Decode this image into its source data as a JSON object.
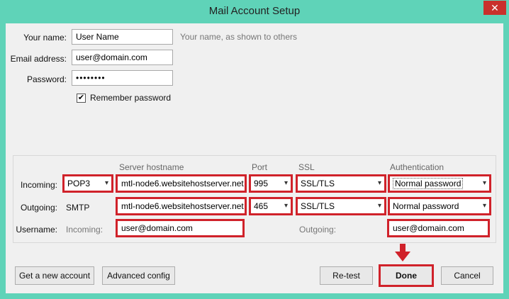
{
  "window": {
    "title": "Mail Account Setup",
    "close_glyph": "✕"
  },
  "identity": {
    "name_label": "Your name:",
    "name_value": "User Name",
    "name_hint": "Your name, as shown to others",
    "email_label": "Email address:",
    "email_value": "user@domain.com",
    "password_label": "Password:",
    "password_value": "••••••••",
    "remember_label": "Remember password",
    "remember_checked": "✔"
  },
  "server": {
    "headers": {
      "hostname": "Server hostname",
      "port": "Port",
      "ssl": "SSL",
      "auth": "Authentication"
    },
    "incoming": {
      "label": "Incoming:",
      "protocol": "POP3",
      "hostname": "mtl-node6.websitehostserver.net",
      "port": "995",
      "ssl": "SSL/TLS",
      "auth": "Normal password"
    },
    "outgoing": {
      "label": "Outgoing:",
      "protocol": "SMTP",
      "hostname": "mtl-node6.websitehostserver.net",
      "port": "465",
      "ssl": "SSL/TLS",
      "auth": "Normal password"
    },
    "username": {
      "label": "Username:",
      "incoming_label": "Incoming:",
      "incoming_value": "user@domain.com",
      "outgoing_label": "Outgoing:",
      "outgoing_value": "user@domain.com"
    }
  },
  "buttons": {
    "new_account": "Get a new account",
    "advanced": "Advanced config",
    "retest": "Re-test",
    "done": "Done",
    "cancel": "Cancel"
  },
  "colors": {
    "highlight": "#d0222a",
    "titlebar": "#5fd3b8"
  },
  "icons": {
    "dropdown": "▾"
  }
}
